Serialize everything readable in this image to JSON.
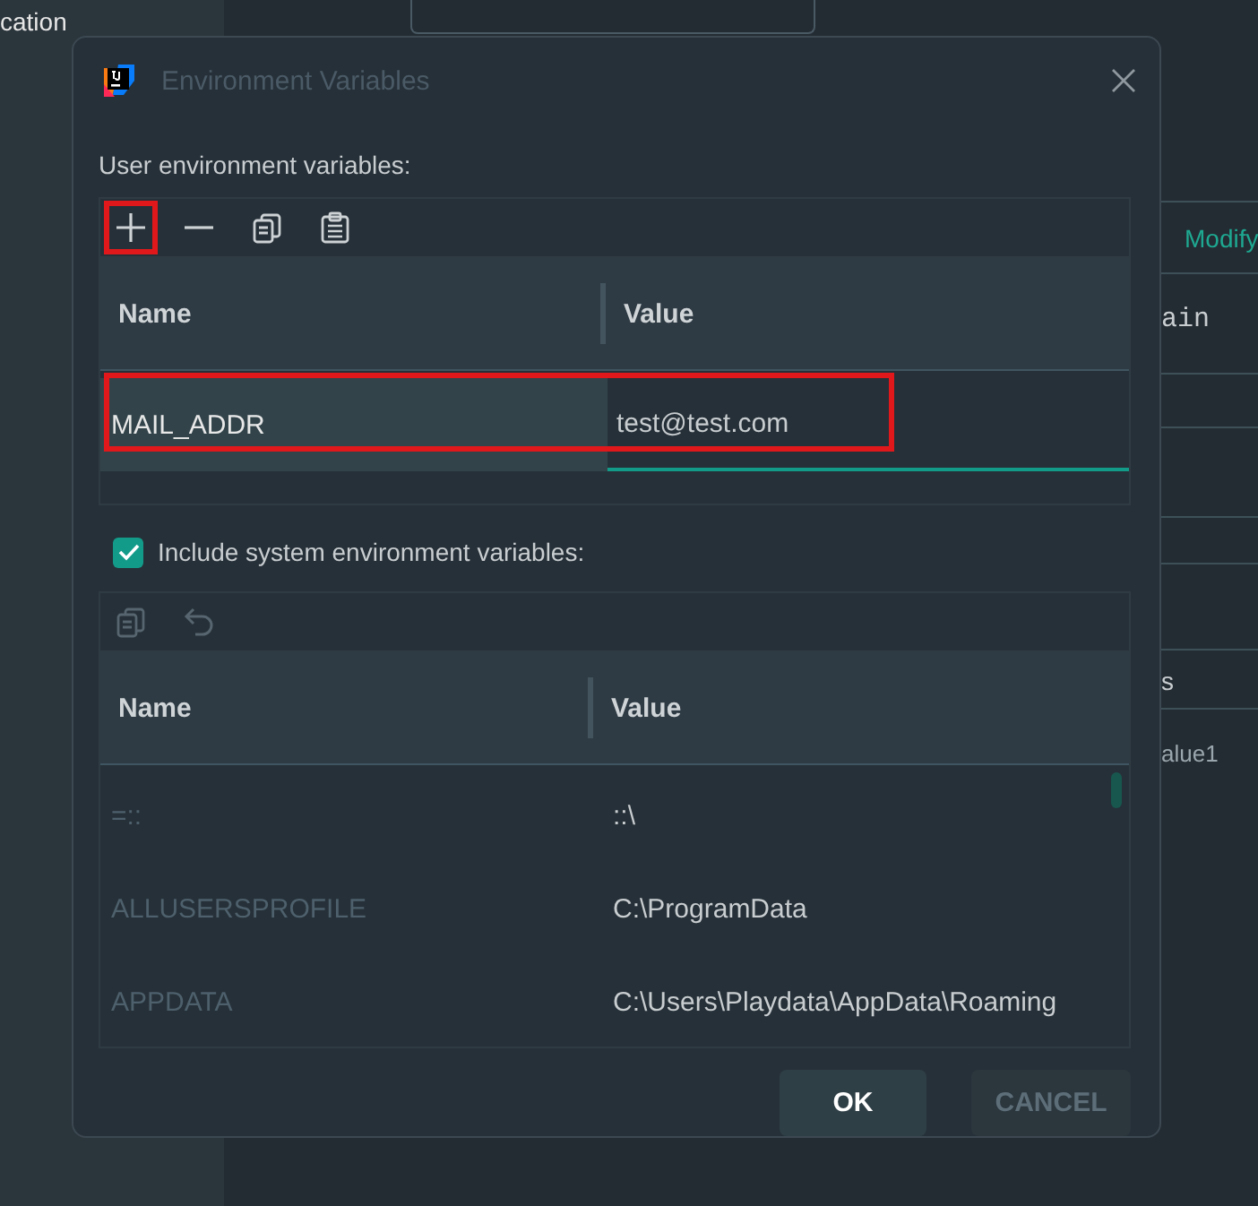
{
  "background": {
    "sidebar_item": "cation",
    "link": "Modify",
    "field_value": "ain",
    "label": "s",
    "cell": "alue1"
  },
  "dialog": {
    "title": "Environment Variables"
  },
  "user_section": {
    "label": "User environment variables:",
    "toolbar": [
      {
        "kind": "add",
        "highlighted": true,
        "disabled": false
      },
      {
        "kind": "remove",
        "highlighted": false,
        "disabled": false
      },
      {
        "kind": "copy",
        "highlighted": false,
        "disabled": false
      },
      {
        "kind": "paste",
        "highlighted": false,
        "disabled": false
      }
    ],
    "columns": [
      "Name",
      "Value"
    ],
    "rows": [
      {
        "name": "MAIL_ADDR",
        "value": "test@test.com",
        "selected": true,
        "editing": true,
        "highlighted": true
      }
    ]
  },
  "include_system": {
    "label": "Include system environment variables:",
    "checked": true
  },
  "system_section": {
    "toolbar": [
      {
        "kind": "copy",
        "highlighted": false,
        "disabled": true
      },
      {
        "kind": "undo",
        "highlighted": false,
        "disabled": true
      }
    ],
    "columns": [
      "Name",
      "Value"
    ],
    "rows": [
      {
        "name": "=::",
        "value": "::\\",
        "selected": false,
        "editing": false,
        "highlighted": false
      },
      {
        "name": "ALLUSERSPROFILE",
        "value": "C:\\ProgramData",
        "selected": false,
        "editing": false,
        "highlighted": false
      },
      {
        "name": "APPDATA",
        "value": "C:\\Users\\Playdata\\AppData\\Roaming",
        "selected": false,
        "editing": false,
        "highlighted": false
      }
    ]
  },
  "buttons": [
    {
      "label": "OK",
      "kind": "default"
    },
    {
      "label": "CANCEL",
      "kind": "secondary"
    }
  ]
}
